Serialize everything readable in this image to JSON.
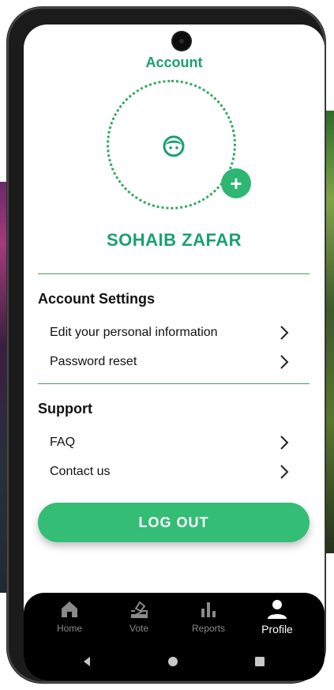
{
  "header": {
    "title": "Account"
  },
  "profile": {
    "name": "SOHAIB ZAFAR",
    "avatar_icon": "face-icon",
    "add_icon": "plus-icon"
  },
  "sections": [
    {
      "title": "Account Settings",
      "items": [
        {
          "label": "Edit your personal information"
        },
        {
          "label": "Password reset"
        }
      ]
    },
    {
      "title": "Support",
      "items": [
        {
          "label": "FAQ"
        },
        {
          "label": "Contact us"
        }
      ]
    }
  ],
  "logout": {
    "label": "LOG OUT"
  },
  "nav": [
    {
      "label": "Home",
      "icon": "home-icon"
    },
    {
      "label": "Vote",
      "icon": "vote-icon"
    },
    {
      "label": "Reports",
      "icon": "bar-chart-icon"
    },
    {
      "label": "Profile",
      "icon": "person-icon",
      "active": true
    }
  ],
  "colors": {
    "accent": "#1aa071",
    "button": "#34bd75",
    "divider": "#4e9a5a"
  }
}
